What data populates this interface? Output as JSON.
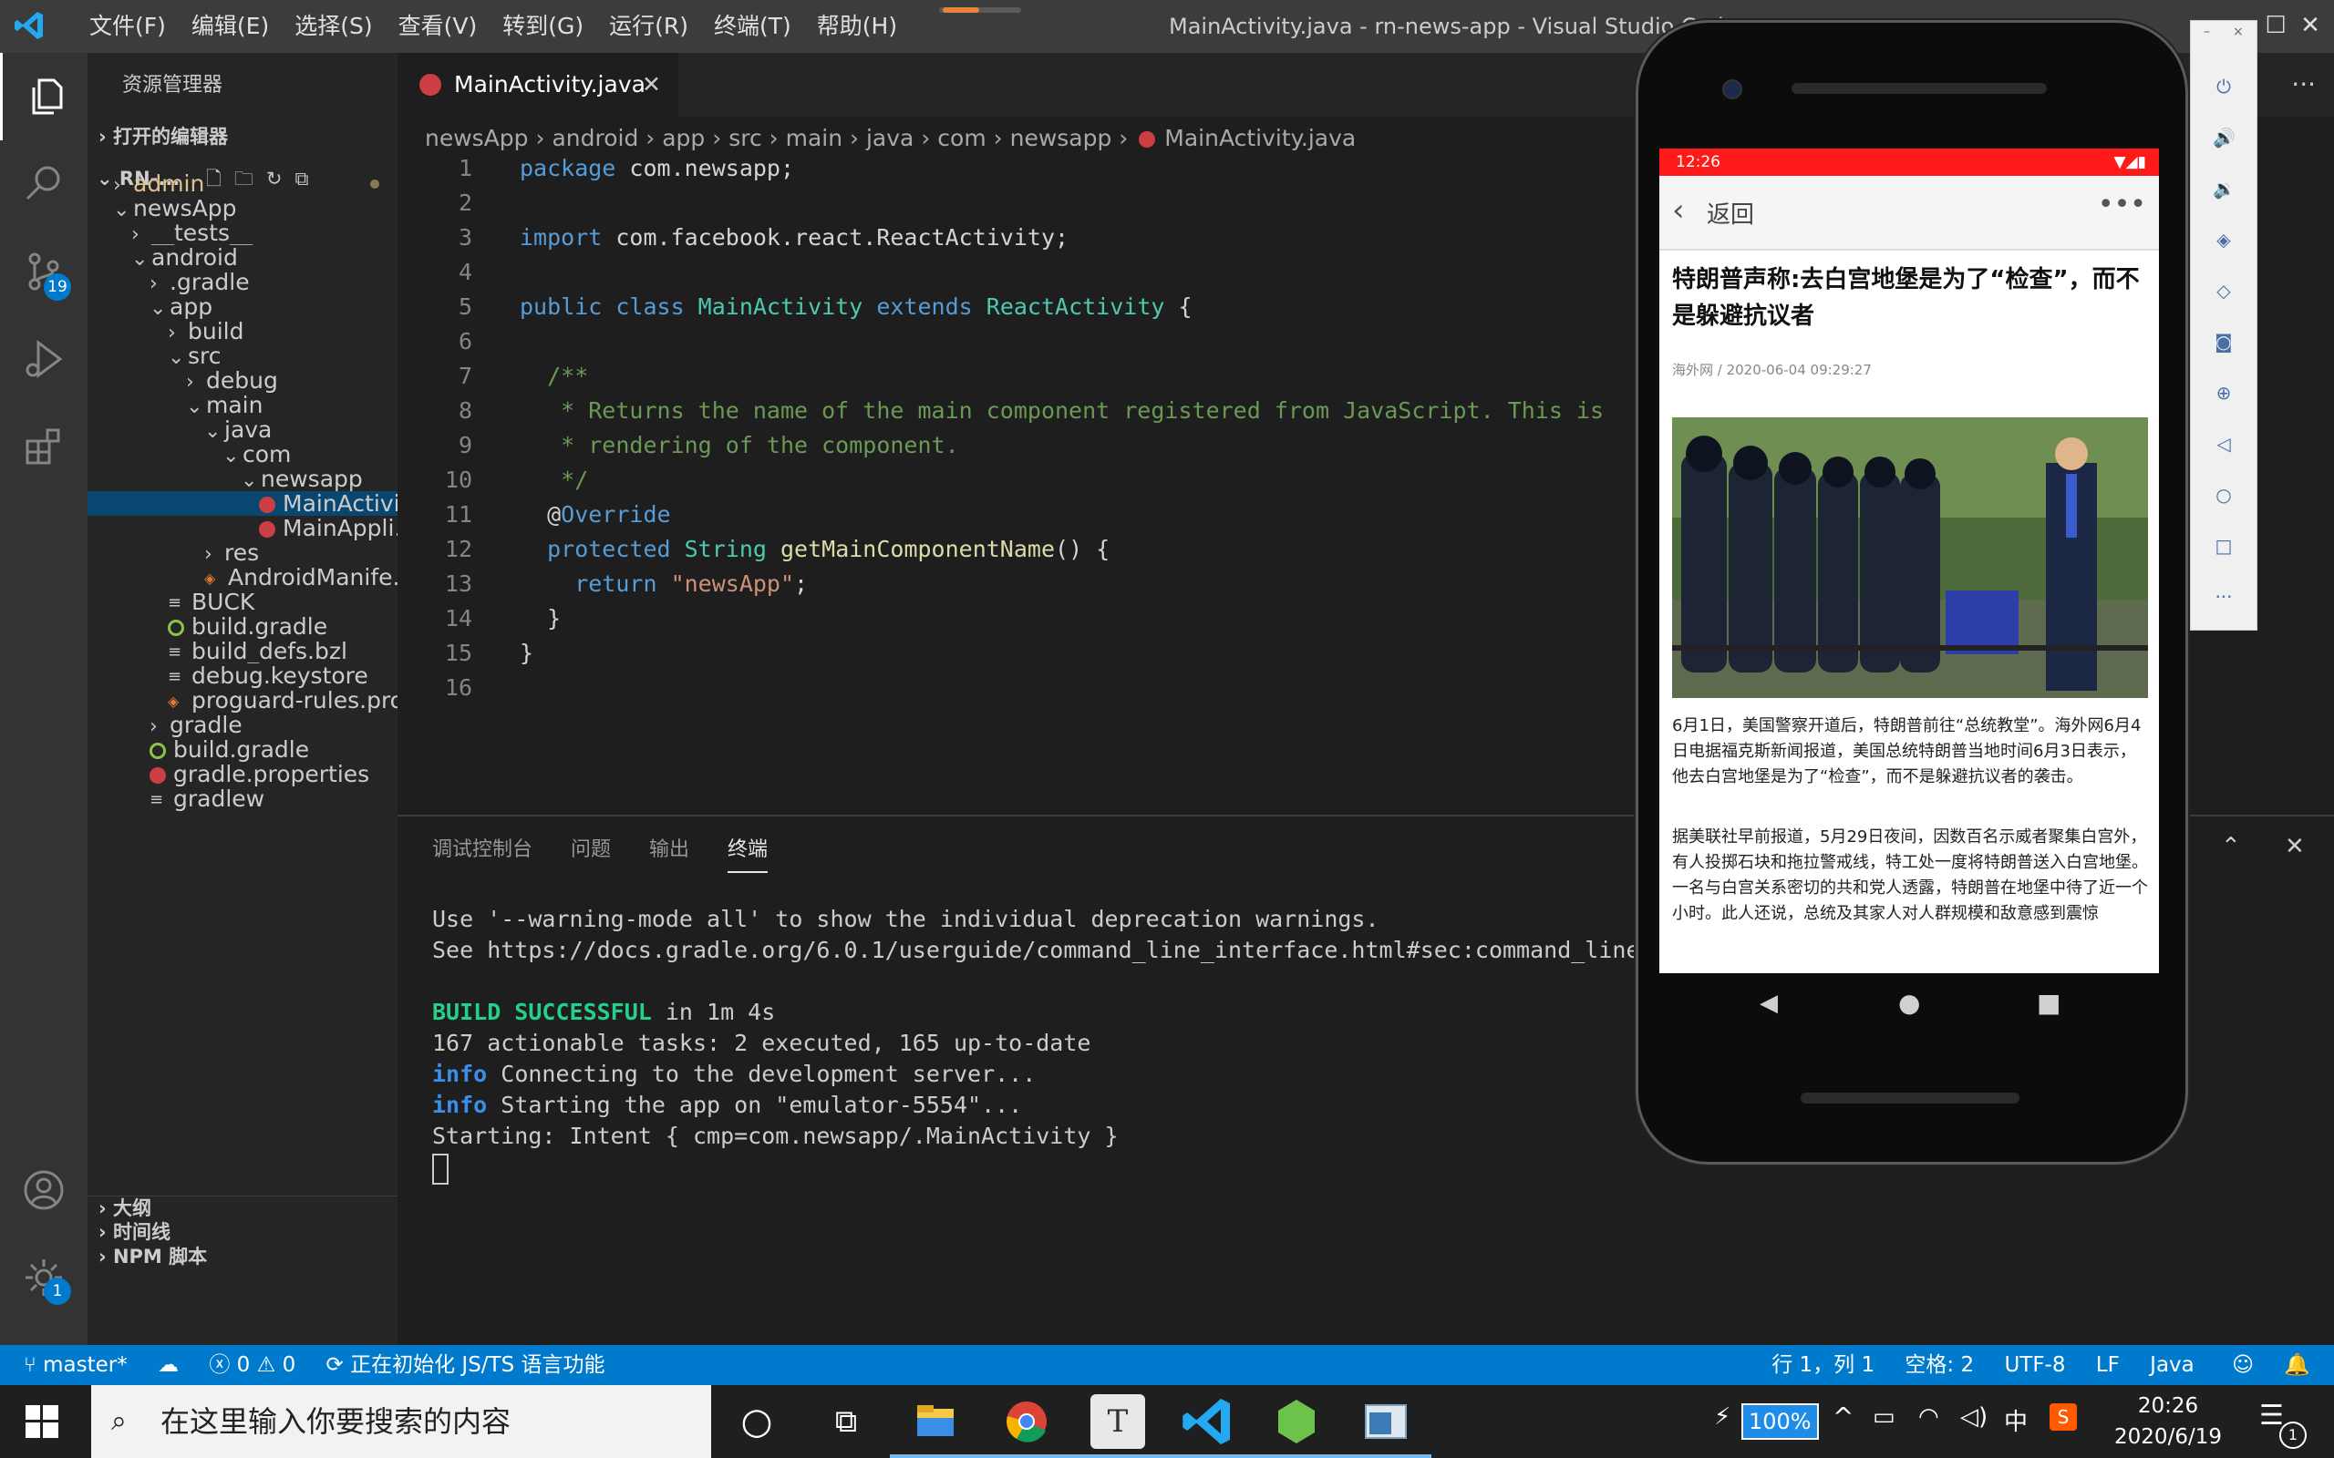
{
  "window": {
    "title": "MainActivity.java - rn-news-app - Visual Studio Code",
    "menu": [
      "文件(F)",
      "编辑(E)",
      "选择(S)",
      "查看(V)",
      "转到(G)",
      "运行(R)",
      "终端(T)",
      "帮助(H)"
    ],
    "more": "···"
  },
  "activity_bar": {
    "scm_badge": "19",
    "settings_badge": "1"
  },
  "sidebar": {
    "title": "资源管理器",
    "open_editors": "打开的编辑器",
    "root": "RN-...",
    "tree": [
      {
        "label": "admin",
        "depth": 1,
        "type": "folder",
        "open": false,
        "color": "#e2c08d"
      },
      {
        "label": "newsApp",
        "depth": 1,
        "type": "folder",
        "open": true
      },
      {
        "label": "__tests__",
        "depth": 2,
        "type": "folder",
        "open": false
      },
      {
        "label": "android",
        "depth": 2,
        "type": "folder",
        "open": true
      },
      {
        "label": ".gradle",
        "depth": 3,
        "type": "folder",
        "open": false
      },
      {
        "label": "app",
        "depth": 3,
        "type": "folder",
        "open": true
      },
      {
        "label": "build",
        "depth": 4,
        "type": "folder",
        "open": false
      },
      {
        "label": "src",
        "depth": 4,
        "type": "folder",
        "open": true
      },
      {
        "label": "debug",
        "depth": 5,
        "type": "folder",
        "open": false
      },
      {
        "label": "main",
        "depth": 5,
        "type": "folder",
        "open": true
      },
      {
        "label": "java",
        "depth": 6,
        "type": "folder",
        "open": true
      },
      {
        "label": "com",
        "depth": 7,
        "type": "folder",
        "open": true
      },
      {
        "label": "newsapp",
        "depth": 8,
        "type": "folder",
        "open": true
      },
      {
        "label": "MainActivi...",
        "depth": 9,
        "type": "java",
        "selected": true
      },
      {
        "label": "MainAppli...",
        "depth": 9,
        "type": "java"
      },
      {
        "label": "res",
        "depth": 6,
        "type": "folder",
        "open": false
      },
      {
        "label": "AndroidManife...",
        "depth": 6,
        "type": "xml"
      },
      {
        "label": "BUCK",
        "depth": 4,
        "type": "text"
      },
      {
        "label": "build.gradle",
        "depth": 4,
        "type": "gradle"
      },
      {
        "label": "build_defs.bzl",
        "depth": 4,
        "type": "text"
      },
      {
        "label": "debug.keystore",
        "depth": 4,
        "type": "text"
      },
      {
        "label": "proguard-rules.pro",
        "depth": 4,
        "type": "pro"
      },
      {
        "label": "gradle",
        "depth": 3,
        "type": "folder",
        "open": false
      },
      {
        "label": "build.gradle",
        "depth": 3,
        "type": "gradle"
      },
      {
        "label": "gradle.properties",
        "depth": 3,
        "type": "java"
      },
      {
        "label": "gradlew",
        "depth": 3,
        "type": "text"
      }
    ],
    "sections": [
      "大纲",
      "时间线",
      "NPM 脚本"
    ]
  },
  "editor": {
    "tab": "MainActivity.java",
    "breadcrumb": [
      "newsApp",
      "android",
      "app",
      "src",
      "main",
      "java",
      "com",
      "newsapp",
      "MainActivity.java"
    ],
    "lines": [
      [
        {
          "t": "package ",
          "c": "kw"
        },
        {
          "t": "com.newsapp;",
          "c": ""
        }
      ],
      [],
      [
        {
          "t": "import ",
          "c": "kw"
        },
        {
          "t": "com.facebook.react.ReactActivity;",
          "c": ""
        }
      ],
      [],
      [
        {
          "t": "public ",
          "c": "kw"
        },
        {
          "t": "class ",
          "c": "kw"
        },
        {
          "t": "MainActivity ",
          "c": "cls"
        },
        {
          "t": "extends ",
          "c": "kw"
        },
        {
          "t": "ReactActivity ",
          "c": "cls"
        },
        {
          "t": "{",
          "c": ""
        }
      ],
      [],
      [
        {
          "t": "  /**",
          "c": "cm"
        }
      ],
      [
        {
          "t": "   * Returns the name of the main component registered from JavaScript. This is ",
          "c": "cm"
        }
      ],
      [
        {
          "t": "   * rendering of the component.",
          "c": "cm"
        }
      ],
      [
        {
          "t": "   */",
          "c": "cm"
        }
      ],
      [
        {
          "t": "  @",
          "c": ""
        },
        {
          "t": "Override",
          "c": "ann"
        }
      ],
      [
        {
          "t": "  protected ",
          "c": "kw"
        },
        {
          "t": "String ",
          "c": "cls"
        },
        {
          "t": "getMainComponentName",
          "c": "fn"
        },
        {
          "t": "() {",
          "c": ""
        }
      ],
      [
        {
          "t": "    return ",
          "c": "kw"
        },
        {
          "t": "\"newsApp\"",
          "c": "str"
        },
        {
          "t": ";",
          "c": ""
        }
      ],
      [
        {
          "t": "  }",
          "c": ""
        }
      ],
      [
        {
          "t": "}",
          "c": ""
        }
      ],
      []
    ]
  },
  "panel": {
    "tabs": [
      "调试控制台",
      "问题",
      "输出",
      "终端"
    ],
    "active_tab": "终端",
    "terminal": [
      [
        {
          "t": "Use '--warning-mode all' to show the individual deprecation warnings.",
          "c": ""
        }
      ],
      [
        {
          "t": "See https://docs.gradle.org/6.0.1/userguide/command_line_interface.html#sec:command_line",
          "c": ""
        }
      ],
      [],
      [
        {
          "t": "BUILD SUCCESSFUL",
          "c": "tg"
        },
        {
          "t": " in 1m 4s",
          "c": ""
        }
      ],
      [
        {
          "t": "167 actionable tasks: 2 executed, 165 up-to-date",
          "c": ""
        }
      ],
      [
        {
          "t": "info",
          "c": "tb"
        },
        {
          "t": " Connecting to the development server...",
          "c": ""
        }
      ],
      [
        {
          "t": "info",
          "c": "tb"
        },
        {
          "t": " Starting the app on \"emulator-5554\"...",
          "c": ""
        }
      ],
      [
        {
          "t": "Starting: Intent { cmp=com.newsapp/.MainActivity }",
          "c": ""
        }
      ]
    ]
  },
  "status": {
    "branch": "master*",
    "errors": "0",
    "warnings": "0",
    "message": "正在初始化 JS/TS 语言功能",
    "position": "行 1，列 1",
    "spaces": "空格: 2",
    "encoding": "UTF-8",
    "eol": "LF",
    "language": "Java"
  },
  "taskbar": {
    "search_placeholder": "在这里输入你要搜索的内容",
    "battery": "100%",
    "time": "20:26",
    "date": "2020/6/19",
    "ime": "中",
    "notif_count": "1"
  },
  "phone": {
    "time": "12:26",
    "back": "返回",
    "headline": "特朗普声称:去白宫地堡是为了“检查”，而不是躲避抗议者",
    "meta": "海外网 / 2020-06-04 09:29:27",
    "para1": "6月1日，美国警察开道后，特朗普前往“总统教堂”。海外网6月4日电据福克斯新闻报道，美国总统特朗普当地时间6月3日表示，他去白宫地堡是为了“检查”，而不是躲避抗议者的袭击。",
    "para2": "据美联社早前报道，5月29日夜间，因数百名示威者聚集白宫外，有人投掷石块和拖拉警戒线，特工处一度将特朗普送入白宫地堡。一名与白宫关系密切的共和党人透露，特朗普在地堡中待了近一个小时。此人还说，总统及其家人对人群规模和敌意感到震惊"
  },
  "colors": {
    "accent": "#007acc",
    "titlebar": "#3c3c3c",
    "sidebar": "#252526",
    "editor": "#1e1e1e",
    "phone_status": "#ff1a1a"
  }
}
